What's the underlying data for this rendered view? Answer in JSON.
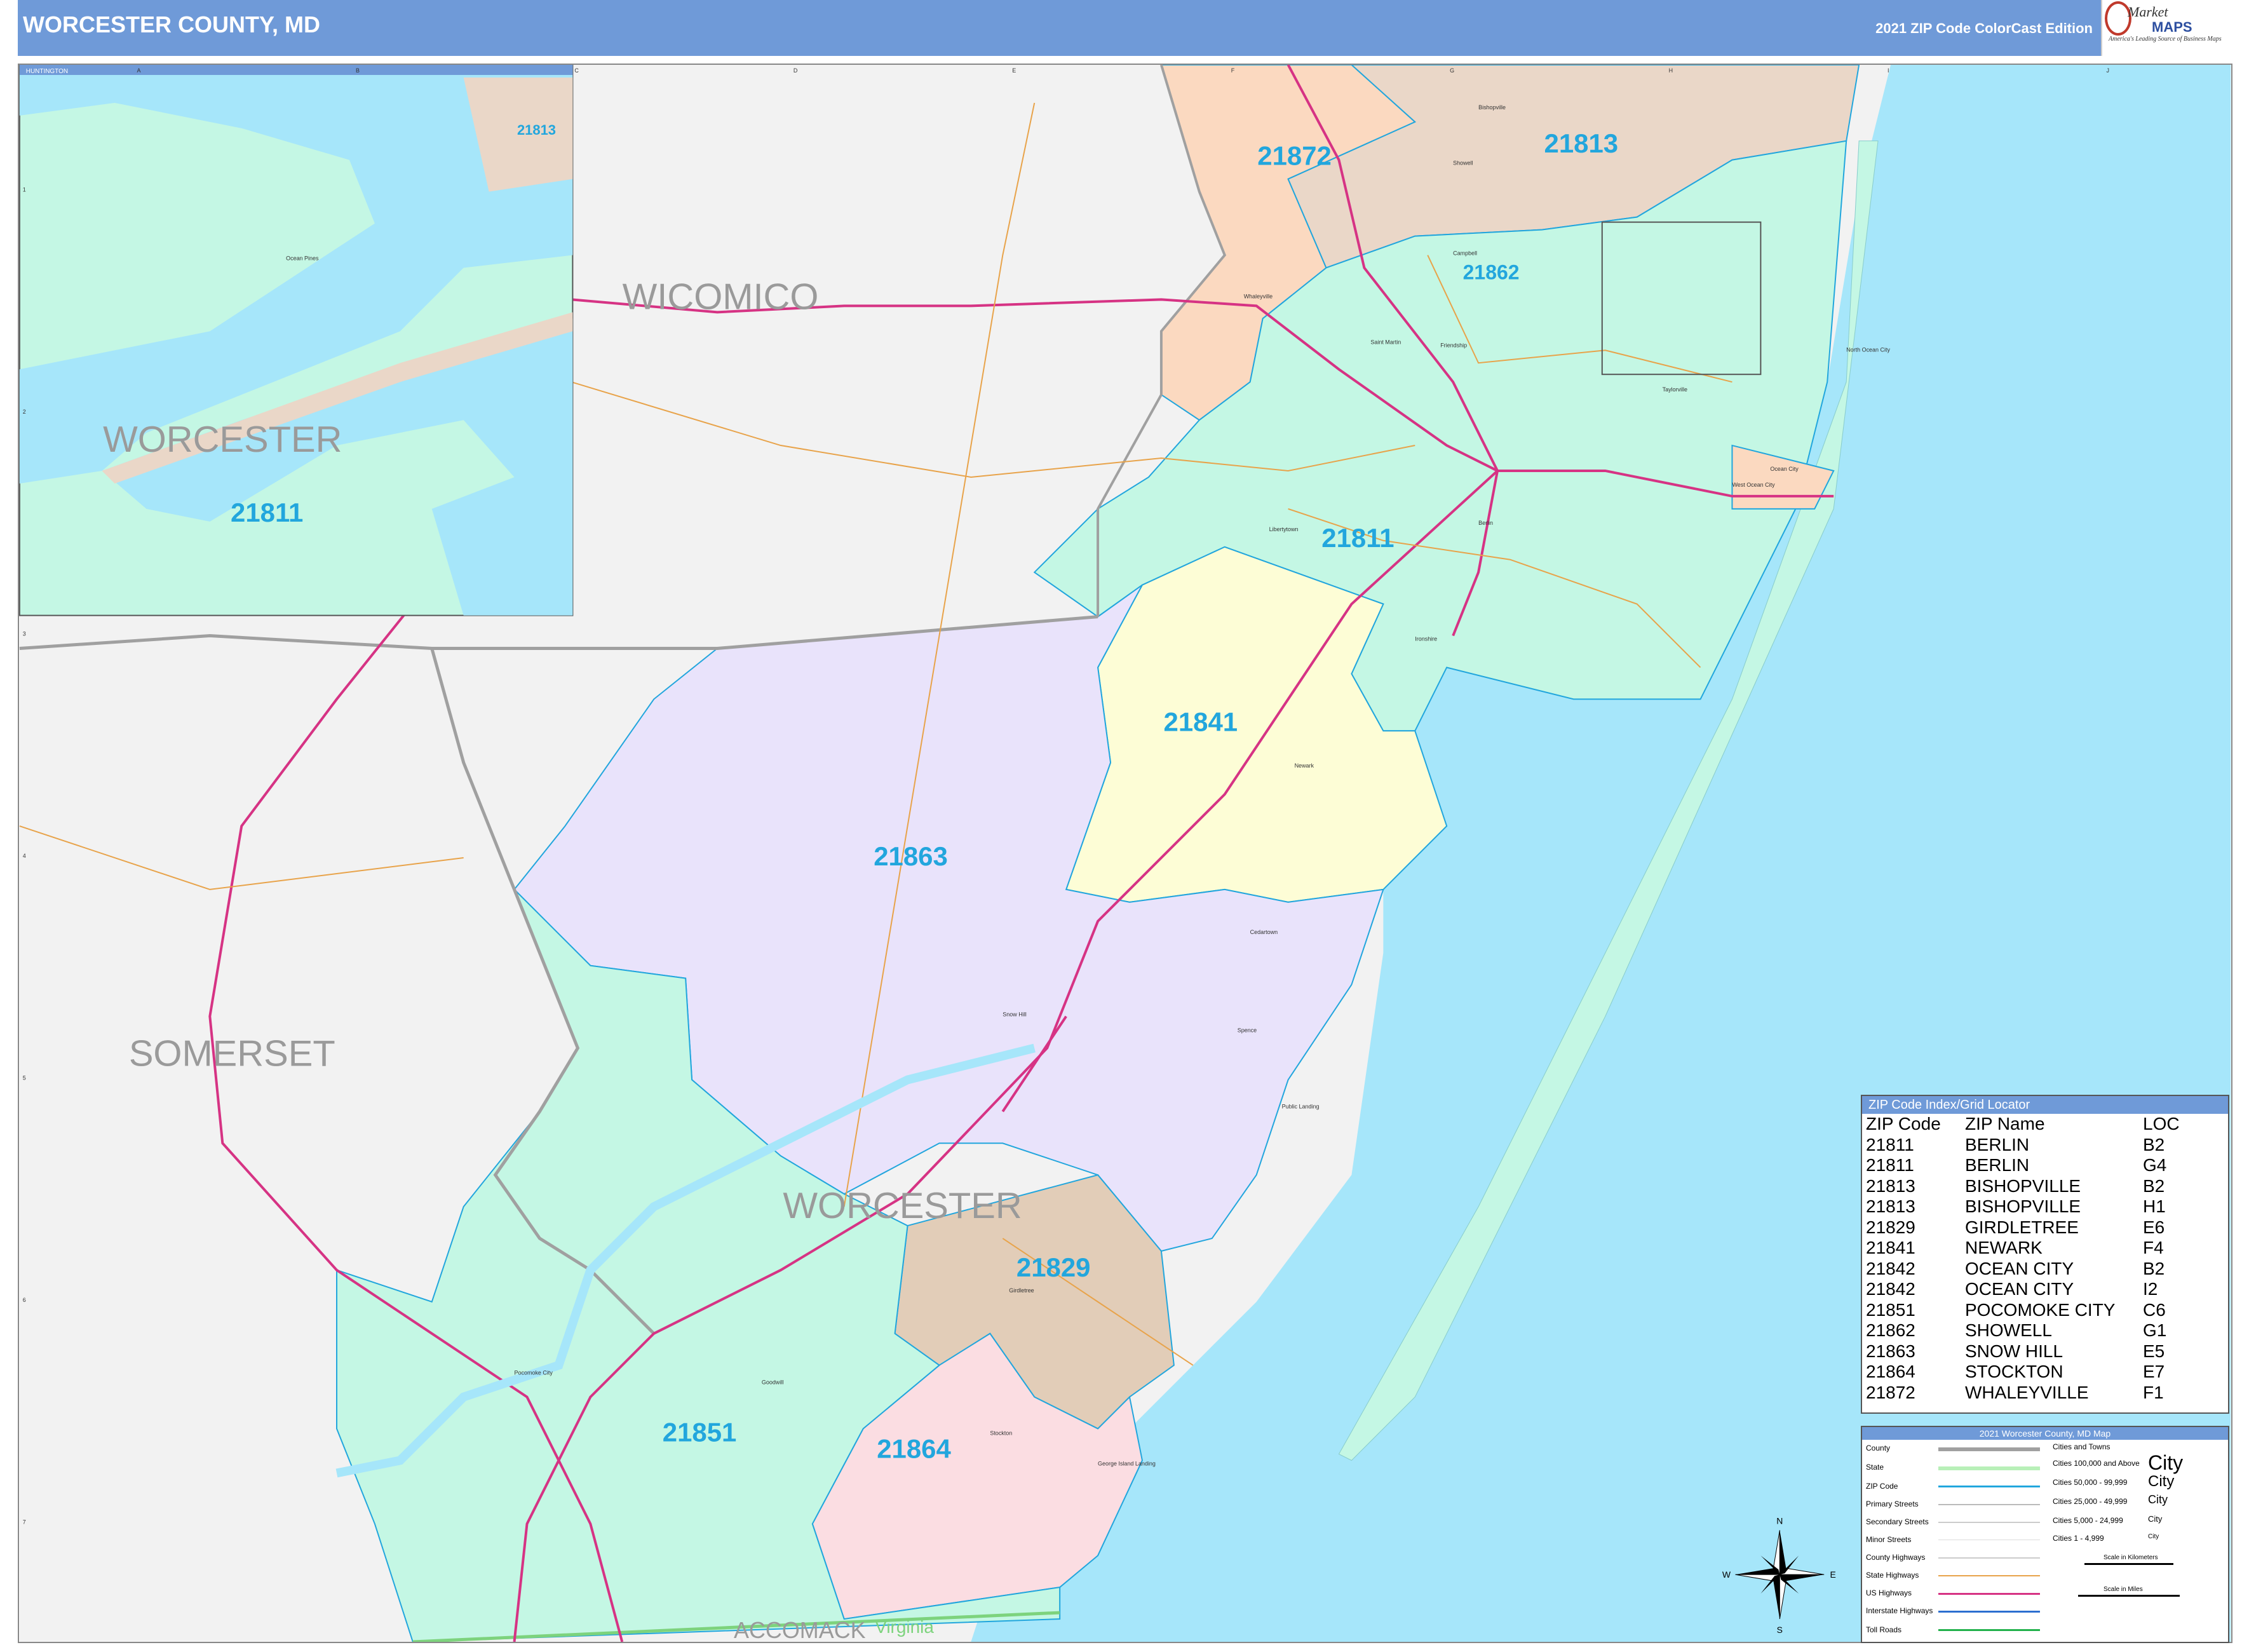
{
  "header": {
    "title": "WORCESTER COUNTY, MD",
    "edition": "2021 ZIP Code ColorCast Edition",
    "logo_line1": "Market",
    "logo_line2": "MAPS",
    "logo_tagline": "America's Leading Source of Business Maps"
  },
  "grid": {
    "columns": [
      "A",
      "B",
      "C",
      "D",
      "E",
      "F",
      "G",
      "H",
      "I",
      "J"
    ],
    "rows": [
      "1",
      "2",
      "3",
      "4",
      "5",
      "6",
      "7"
    ]
  },
  "counties": {
    "wicomico": "WICOMICO",
    "somerset": "SOMERSET",
    "worcester": "WORCESTER",
    "accomack": "ACCOMACK",
    "virginia": "Virginia"
  },
  "zip_labels": {
    "z21872": "21872",
    "z21813": "21813",
    "z21862": "21862",
    "z21811": "21811",
    "z21841": "21841",
    "z21863": "21863",
    "z21829": "21829",
    "z21851": "21851",
    "z21864": "21864"
  },
  "places": {
    "bishopville": "Bishopville",
    "showell": "Showell",
    "campbell": "Campbell",
    "whaleyville": "Whaleyville",
    "saint_martin": "Saint Martin",
    "friendship": "Friendship",
    "berlin": "Berlin",
    "ocean_city": "Ocean City",
    "west_ocean_city": "West Ocean City",
    "north_ocean_city": "North Ocean City",
    "newark": "Newark",
    "snow_hill": "Snow Hill",
    "girdletree": "Girdletree",
    "stockton": "Stockton",
    "pocomoke_city": "Pocomoke City",
    "libertytown": "Libertytown",
    "taylorville": "Taylorville",
    "ironshire": "Ironshire",
    "public_landing": "Public Landing",
    "cedartown": "Cedartown",
    "spence": "Spence",
    "goodwill": "Goodwill",
    "george_island_landing": "George Island Landing"
  },
  "inset": {
    "title": "HUNTINGTON",
    "zip_small": "21813",
    "county": "WORCESTER",
    "zip_main": "21811",
    "place": "Ocean Pines"
  },
  "index": {
    "title": "ZIP Code Index/Grid Locator",
    "headers": [
      "ZIP Code",
      "ZIP Name",
      "LOC"
    ],
    "rows": [
      [
        "21811",
        "BERLIN",
        "B2"
      ],
      [
        "21811",
        "BERLIN",
        "G4"
      ],
      [
        "21813",
        "BISHOPVILLE",
        "B2"
      ],
      [
        "21813",
        "BISHOPVILLE",
        "H1"
      ],
      [
        "21829",
        "GIRDLETREE",
        "E6"
      ],
      [
        "21841",
        "NEWARK",
        "F4"
      ],
      [
        "21842",
        "OCEAN CITY",
        "B2"
      ],
      [
        "21842",
        "OCEAN CITY",
        "I2"
      ],
      [
        "21851",
        "POCOMOKE CITY",
        "C6"
      ],
      [
        "21862",
        "SHOWELL",
        "G1"
      ],
      [
        "21863",
        "SNOW HILL",
        "E5"
      ],
      [
        "21864",
        "STOCKTON",
        "E7"
      ],
      [
        "21872",
        "WHALEYVILLE",
        "F1"
      ]
    ]
  },
  "legend": {
    "title": "2021 Worcester County, MD Map",
    "items": [
      "County",
      "State",
      "ZIP Code",
      "Primary Streets",
      "Secondary Streets",
      "Minor Streets",
      "County Highways",
      "State Highways",
      "US Highways",
      "Interstate Highways",
      "Toll Roads"
    ],
    "cities_heading": "Cities and Towns",
    "city_classes": [
      "Cities 100,000 and Above",
      "Cities 50,000 - 99,999",
      "Cities 25,000 - 49,999",
      "Cities 5,000 - 24,999",
      "Cities 1 - 4,999"
    ],
    "city_word": "City",
    "scale_km": "Scale in Kilometers",
    "scale_mi": "Scale in Miles",
    "compass": {
      "n": "N",
      "s": "S",
      "e": "E",
      "w": "W"
    }
  },
  "colors": {
    "water": "#a6e6fa",
    "z21811": "#c4f7e4",
    "z21813": "#ead7c8",
    "z21872": "#fbd9c0",
    "z21841": "#fdfdd6",
    "z21863": "#e9e3fb",
    "z21829": "#e2cdb8",
    "z21864": "#fbdde2",
    "z21851": "#c4f7e4",
    "z21862": "#fbdde8",
    "outside": "#f2f2f2",
    "zip_label": "#22a6dd",
    "us_highway": "#d63384"
  }
}
